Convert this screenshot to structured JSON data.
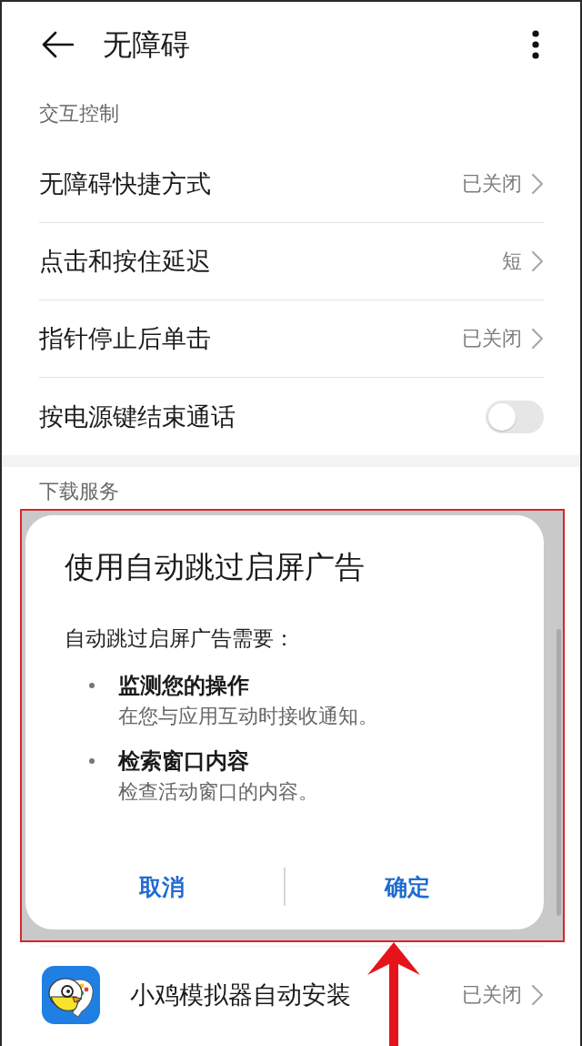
{
  "top_bar": {
    "title": "无障碍"
  },
  "settings_group": {
    "title": "交互控制",
    "items": [
      {
        "kind": "link",
        "label": "无障碍快捷方式",
        "value": "已关闭"
      },
      {
        "kind": "link",
        "label": "点击和按住延迟",
        "value": "短"
      },
      {
        "kind": "link",
        "label": "指针停止后单击",
        "value": "已关闭"
      },
      {
        "kind": "switch",
        "label": "按电源键结束通话",
        "on": false
      }
    ]
  },
  "download_group": {
    "title": "下载服务"
  },
  "dialog": {
    "title": "使用自动跳过启屏广告",
    "intro": "自动跳过启屏广告需要：",
    "permissions": [
      {
        "title": "监测您的操作",
        "description": "在您与应用互动时接收通知。"
      },
      {
        "title": "检索窗口内容",
        "description": "检查活动窗口的内容。"
      }
    ],
    "buttons": [
      "取消",
      "确定"
    ]
  },
  "app_row": {
    "label": "小鸡模拟器自动安装",
    "value": "已关闭"
  }
}
